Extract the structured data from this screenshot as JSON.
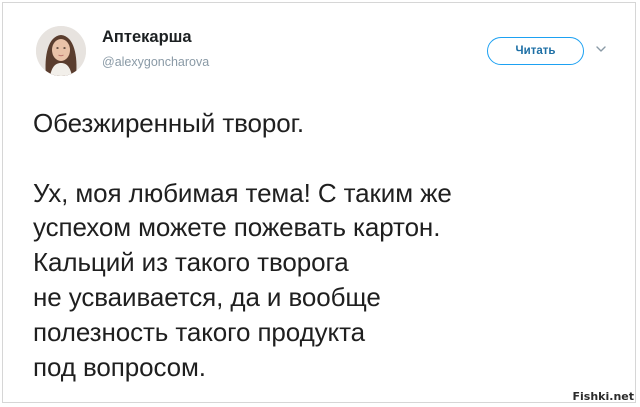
{
  "author": {
    "name": "Аптекарша",
    "handle": "@alexygoncharova"
  },
  "header": {
    "follow_label": "Читать",
    "menu_icon": "chevron-down-icon"
  },
  "tweet": {
    "text": "Обезжиренный творог.\n\nУх, моя любимая тема! С таким же\nуспехом можете пожевать картон.\nКальций из такого творога\nне усваивается, да и вообще\nполезность такого продукта\nпод вопросом."
  },
  "watermark": {
    "text": "Fishki.net"
  },
  "colors": {
    "accent": "#1da1f2",
    "text": "#1f1f1f",
    "muted": "#8a9aa6"
  }
}
